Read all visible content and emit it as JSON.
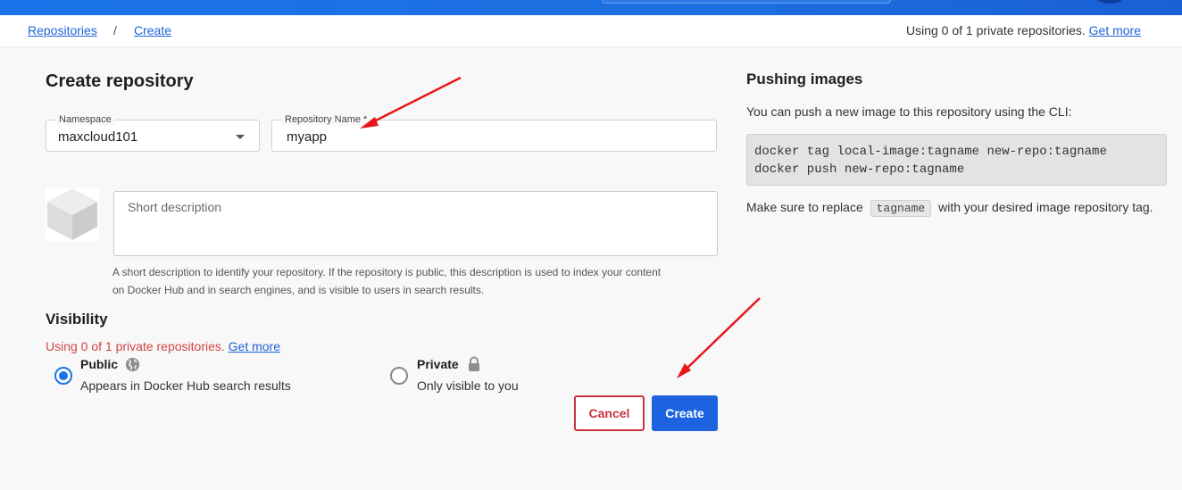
{
  "breadcrumb": {
    "repositories": "Repositories",
    "separator": "/",
    "create": "Create"
  },
  "usage": {
    "text": "Using 0 of 1 private repositories.",
    "link": "Get more"
  },
  "form": {
    "title": "Create repository",
    "namespace": {
      "label": "Namespace",
      "value": "maxcloud101"
    },
    "repo_name": {
      "label": "Repository Name *",
      "value": "myapp"
    },
    "description": {
      "placeholder": "Short description",
      "help_line1": "A short description to identify your repository. If the repository is public, this description is used to index your content",
      "help_line2": "on Docker Hub and in search engines, and is visible to users in search results."
    }
  },
  "visibility": {
    "title": "Visibility",
    "warning": "Using 0 of 1 private repositories.",
    "warning_link": "Get more",
    "public": {
      "title": "Public",
      "subtitle": "Appears in Docker Hub search results",
      "selected": true
    },
    "private": {
      "title": "Private",
      "subtitle": "Only visible to you",
      "selected": false
    }
  },
  "actions": {
    "cancel": "Cancel",
    "create": "Create"
  },
  "sidebar": {
    "title": "Pushing images",
    "intro": "You can push a new image to this repository using the CLI:",
    "code_line1": "docker tag local-image:tagname new-repo:tagname",
    "code_line2": "docker push new-repo:tagname",
    "replace_before": "Make sure to replace",
    "replace_chip": "tagname",
    "replace_after": "with your desired image repository tag."
  },
  "colors": {
    "accent": "#1d63e0",
    "danger": "#c8333f",
    "warning_text": "#d04444",
    "annotation_arrow": "#e8161b"
  },
  "icons": {
    "namespace_dropdown": "chevron-down-icon",
    "public": "globe-icon",
    "private": "lock-icon",
    "repo_image": "cube-icon"
  }
}
